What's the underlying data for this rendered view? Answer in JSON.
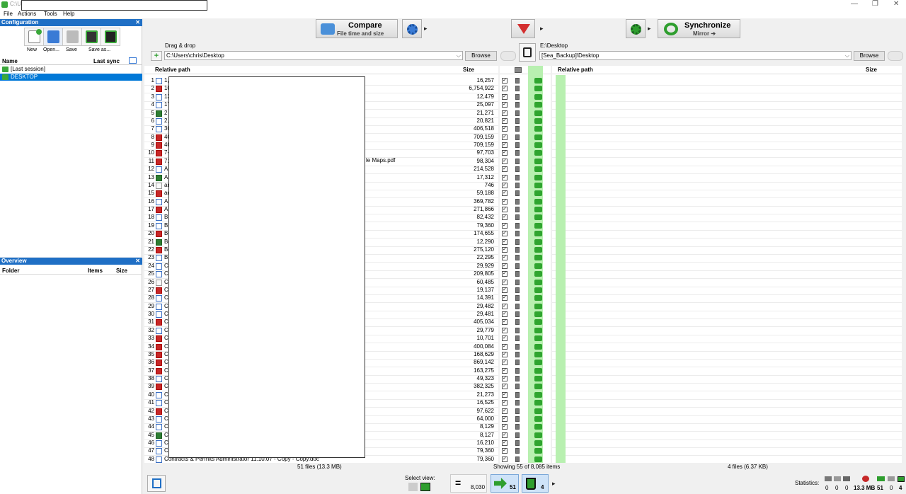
{
  "window": {
    "title": "C:\\U",
    "controls": [
      "—",
      "❐",
      "✕"
    ]
  },
  "menu": [
    "File",
    "Actions",
    "Tools",
    "Help"
  ],
  "config": {
    "header": "Configuration",
    "buttons": [
      {
        "label": "New",
        "icon": "new-config-icon"
      },
      {
        "label": "Open...",
        "icon": "open-config-icon"
      },
      {
        "label": "Save",
        "icon": "save-icon"
      },
      {
        "label": "Save as...",
        "icon": "save-as-icon"
      }
    ],
    "col_name": "Name",
    "col_last_sync": "Last sync",
    "items": [
      {
        "name": "[Last session]",
        "selected": false
      },
      {
        "name": "DESKTOP",
        "selected": true
      }
    ]
  },
  "overview": {
    "header": "Overview",
    "col_folder": "Folder",
    "col_items": "Items",
    "col_size": "Size"
  },
  "toolbar": {
    "compare_title": "Compare",
    "compare_sub": "File time and size",
    "sync_title": "Synchronize",
    "sync_sub": "Mirror"
  },
  "left_path": {
    "label": "Drag & drop",
    "value": "C:\\Users\\chris\\Desktop",
    "browse": "Browse"
  },
  "right_path": {
    "label": "E:\\Desktop",
    "value": "[Sea_Backup]\\Desktop",
    "browse": "Browse"
  },
  "left_grid": {
    "col_path": "Relative path",
    "col_size": "Size",
    "rows": [
      {
        "n": "1",
        "t": "doc",
        "name": "1,",
        "size": "16,257"
      },
      {
        "n": "2",
        "t": "pdf",
        "name": "10",
        "size": "6,754,922"
      },
      {
        "n": "3",
        "t": "doc",
        "name": "13",
        "size": "12,479"
      },
      {
        "n": "4",
        "t": "doc",
        "name": "17",
        "size": "25,097"
      },
      {
        "n": "5",
        "t": "xls",
        "name": "2",
        "size": "21,271"
      },
      {
        "n": "6",
        "t": "doc",
        "name": "2.",
        "size": "20,821"
      },
      {
        "n": "7",
        "t": "doc",
        "name": "30",
        "size": "406,518"
      },
      {
        "n": "8",
        "t": "pdf",
        "name": "40",
        "size": "709,159"
      },
      {
        "n": "9",
        "t": "pdf",
        "name": "40",
        "size": "709,159"
      },
      {
        "n": "10",
        "t": "pdf",
        "name": "7-",
        "size": "97,703"
      },
      {
        "n": "11",
        "t": "pdf",
        "name": "71",
        "size": "98,304"
      },
      {
        "n": "12",
        "t": "doc",
        "name": "Ar",
        "size": "214,528"
      },
      {
        "n": "13",
        "t": "xls",
        "name": "Ar",
        "size": "17,312"
      },
      {
        "n": "14",
        "t": "gen",
        "name": "ar",
        "size": "746"
      },
      {
        "n": "15",
        "t": "pdf",
        "name": "aq",
        "size": "59,188"
      },
      {
        "n": "16",
        "t": "doc",
        "name": "Ar",
        "size": "369,782"
      },
      {
        "n": "17",
        "t": "pdf",
        "name": "AU",
        "size": "271,866"
      },
      {
        "n": "18",
        "t": "doc",
        "name": "BL",
        "size": "82,432"
      },
      {
        "n": "19",
        "t": "doc",
        "name": "BL",
        "size": "79,360"
      },
      {
        "n": "20",
        "t": "pdf",
        "name": "BC",
        "size": "174,655"
      },
      {
        "n": "21",
        "t": "xls",
        "name": "Bo",
        "size": "12,290"
      },
      {
        "n": "22",
        "t": "pdf",
        "name": "Bo",
        "size": "275,120"
      },
      {
        "n": "23",
        "t": "doc",
        "name": "BS",
        "size": "22,295"
      },
      {
        "n": "24",
        "t": "doc",
        "name": "C",
        "size": "29,929"
      },
      {
        "n": "25",
        "t": "doc",
        "name": "C8",
        "size": "209,805"
      },
      {
        "n": "26",
        "t": "gen",
        "name": "Ca",
        "size": "60,485"
      },
      {
        "n": "27",
        "t": "pdf",
        "name": "CA",
        "size": "19,137"
      },
      {
        "n": "28",
        "t": "doc",
        "name": "Ch",
        "size": "14,391"
      },
      {
        "n": "29",
        "t": "doc",
        "name": "CH",
        "size": "29,482"
      },
      {
        "n": "30",
        "t": "doc",
        "name": "Ch",
        "size": "29,481"
      },
      {
        "n": "31",
        "t": "pdf",
        "name": "Ch",
        "size": "405,034"
      },
      {
        "n": "32",
        "t": "doc",
        "name": "Ch",
        "size": "29,779"
      },
      {
        "n": "33",
        "t": "pdf",
        "name": "Ch",
        "size": "10,701"
      },
      {
        "n": "34",
        "t": "pdf",
        "name": "Ch",
        "size": "400,084"
      },
      {
        "n": "35",
        "t": "pdf",
        "name": "Ch",
        "size": "168,629"
      },
      {
        "n": "36",
        "t": "pdf",
        "name": "Ch",
        "size": "869,142"
      },
      {
        "n": "37",
        "t": "pdf",
        "name": "CL",
        "size": "163,275"
      },
      {
        "n": "38",
        "t": "doc",
        "name": "CL",
        "size": "49,323"
      },
      {
        "n": "39",
        "t": "pdf",
        "name": "CL",
        "size": "382,325"
      },
      {
        "n": "40",
        "t": "doc",
        "name": "CL",
        "size": "21,273"
      },
      {
        "n": "41",
        "t": "doc",
        "name": "Co",
        "size": "16,525"
      },
      {
        "n": "42",
        "t": "pdf",
        "name": "Co",
        "size": "97,622"
      },
      {
        "n": "43",
        "t": "doc",
        "name": "Co",
        "size": "64,000"
      },
      {
        "n": "44",
        "t": "doc",
        "name": "Co",
        "size": "8,129"
      },
      {
        "n": "45",
        "t": "xls",
        "name": "Co",
        "size": "8,127"
      },
      {
        "n": "46",
        "t": "doc",
        "name": "Co",
        "size": "16,210"
      },
      {
        "n": "47",
        "t": "doc",
        "name": "Co",
        "size": "79,360"
      },
      {
        "n": "48",
        "t": "doc",
        "name": "Contracts & Permits Administrator 11.10.07 - Copy - Copy.doc",
        "size": "79,360"
      }
    ],
    "overflow_text": "le Maps.pdf"
  },
  "right_grid": {
    "col_path": "Relative path",
    "col_size": "Size"
  },
  "status": {
    "left": "51 files (13.3 MB)",
    "center": "Showing 55 of 8,085 items",
    "right": "4 files (6.37 KB)"
  },
  "bottom": {
    "select_view": "Select view:",
    "equal_count": "8,030",
    "copy_count": "51",
    "delete_count": "4",
    "statistics_label": "Statistics:",
    "stats": [
      "0",
      "0",
      "0",
      "13.3 MB",
      "51",
      "0",
      "4"
    ]
  }
}
